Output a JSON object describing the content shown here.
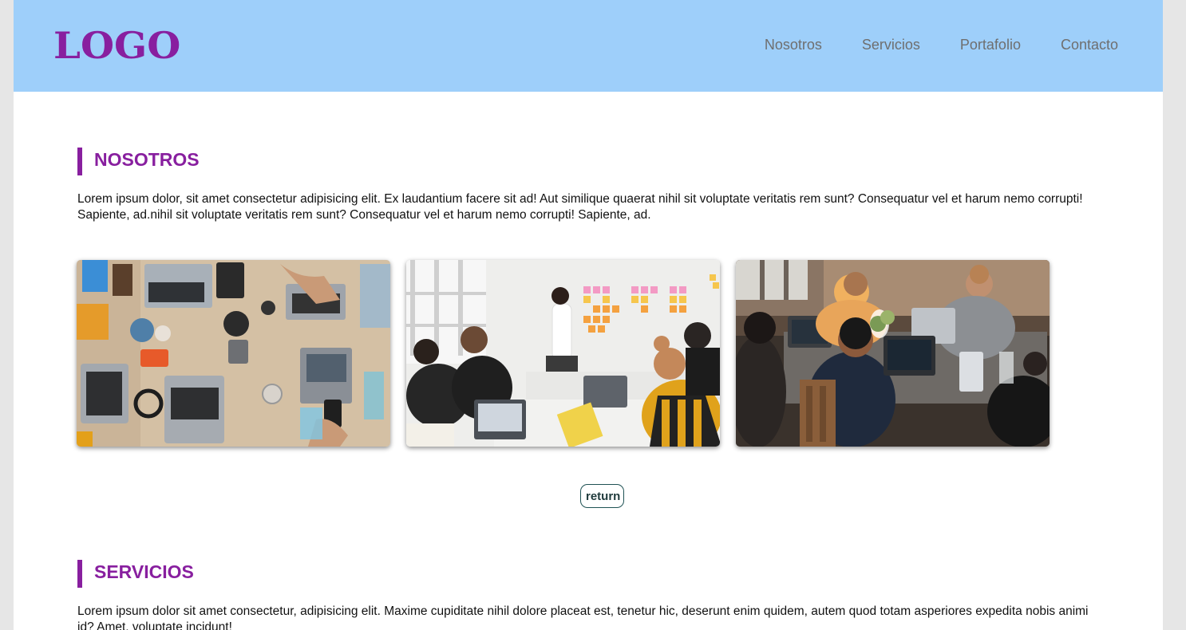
{
  "header": {
    "logo_text": "LOGO",
    "nav": [
      "Nosotros",
      "Servicios",
      "Portafolio",
      "Contacto"
    ]
  },
  "sections": {
    "nosotros": {
      "title": "NOSOTROS",
      "text": "Lorem ipsum dolor, sit amet consectetur adipisicing elit. Ex laudantium facere sit ad! Aut similique quaerat nihil sit voluptate veritatis rem sunt? Consequatur vel et harum nemo corrupti! Sapiente, ad.nihil sit voluptate veritatis rem sunt? Consequatur vel et harum nemo corrupti! Sapiente, ad.",
      "return_label": "return"
    },
    "servicios": {
      "title": "SERVICIOS",
      "text": "Lorem ipsum dolor sit amet consectetur, adipisicing elit. Maxime cupiditate nihil dolore placeat est, tenetur hic, deserunt enim quidem, autem quod totam asperiores expedita nobis animi id? Amet, voluptate incidunt!"
    }
  },
  "colors": {
    "header_bg": "#9ecffa",
    "brand_purple": "#881f9f",
    "nav_text": "#6f6f6f",
    "button_border": "#1f5254"
  }
}
